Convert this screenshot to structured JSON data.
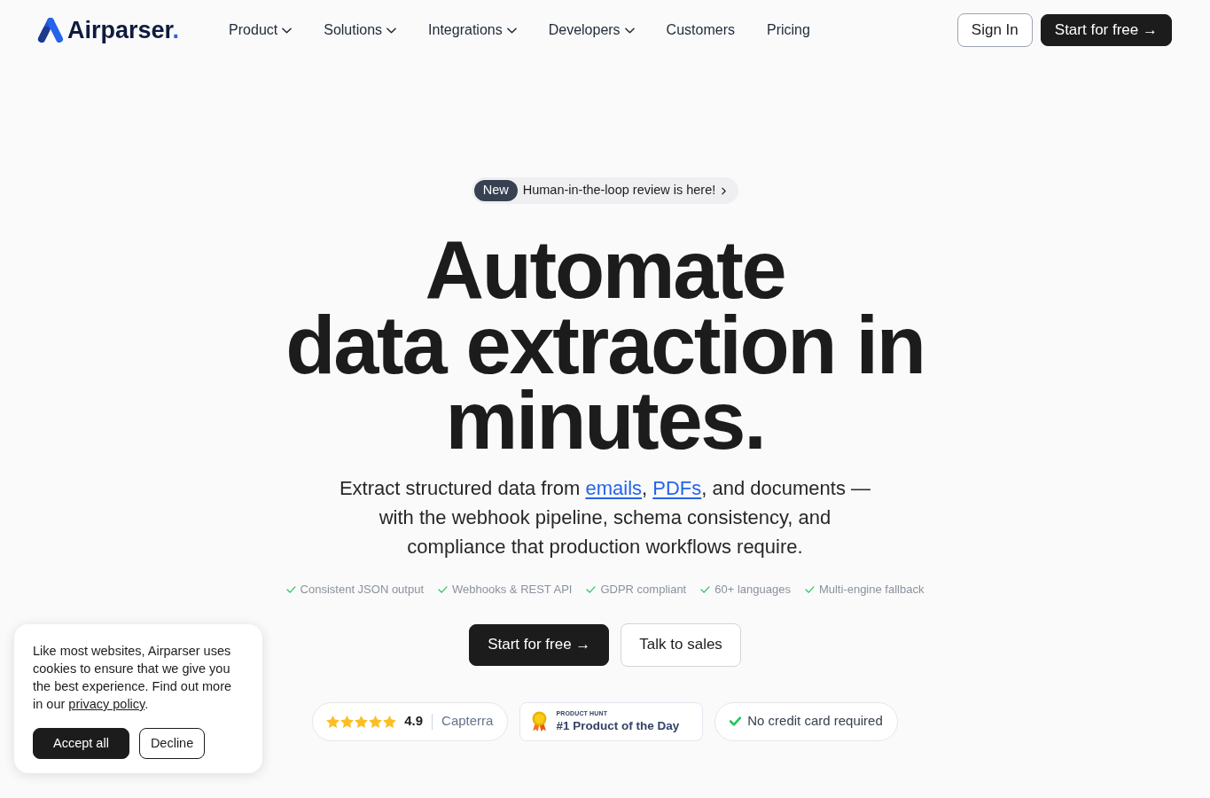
{
  "header": {
    "logo": {
      "name": "Airparser",
      "dot": "."
    },
    "nav": [
      {
        "label": "Product",
        "has_menu": true
      },
      {
        "label": "Solutions",
        "has_menu": true
      },
      {
        "label": "Integrations",
        "has_menu": true
      },
      {
        "label": "Developers",
        "has_menu": true
      },
      {
        "label": "Customers",
        "has_menu": false
      },
      {
        "label": "Pricing",
        "has_menu": false
      }
    ],
    "buttons": [
      {
        "label": "Sign In",
        "kind": "outline"
      },
      {
        "label": "Start for free →",
        "kind": "primary"
      }
    ]
  },
  "announcement": {
    "tag": "New",
    "text": "Human-in-the-loop review is here!"
  },
  "hero": {
    "headline_lines": [
      "Automate",
      "data extraction in",
      "minutes."
    ],
    "subtitle": [
      {
        "kind": "text",
        "text": "Extract structured data from "
      },
      {
        "kind": "link",
        "text": "emails"
      },
      {
        "kind": "text",
        "text": ", "
      },
      {
        "kind": "link",
        "text": "PDFs"
      },
      {
        "kind": "text",
        "text": ", and documents — with the webhook pipeline, schema consistency, and compliance that production workflows require."
      }
    ],
    "features": [
      "Consistent JSON output",
      "Webhooks & REST API",
      "GDPR compliant",
      "60+ languages",
      "Multi-engine fallback"
    ],
    "buttons": [
      {
        "label": "Start for free →",
        "kind": "primary"
      },
      {
        "label": "Talk to sales",
        "kind": "outline"
      }
    ],
    "badges": [
      {
        "kind": "rating",
        "stars": 5,
        "score": "4.9",
        "source": "Capterra"
      },
      {
        "kind": "award",
        "eyebrow": "PRODUCT HUNT",
        "title": "#1 Product of the Day"
      },
      {
        "kind": "note",
        "text": "No credit card required"
      }
    ]
  },
  "cookie_banner": {
    "text": [
      {
        "kind": "text",
        "text": "Like most websites, Airparser uses cookies to ensure that we give you the best experience. Find out more in our "
      },
      {
        "kind": "link",
        "text": "privacy policy"
      },
      {
        "kind": "text",
        "text": "."
      }
    ],
    "buttons": [
      {
        "label": "Accept all",
        "kind": "primary"
      },
      {
        "label": "Decline",
        "kind": "outline"
      }
    ]
  }
}
